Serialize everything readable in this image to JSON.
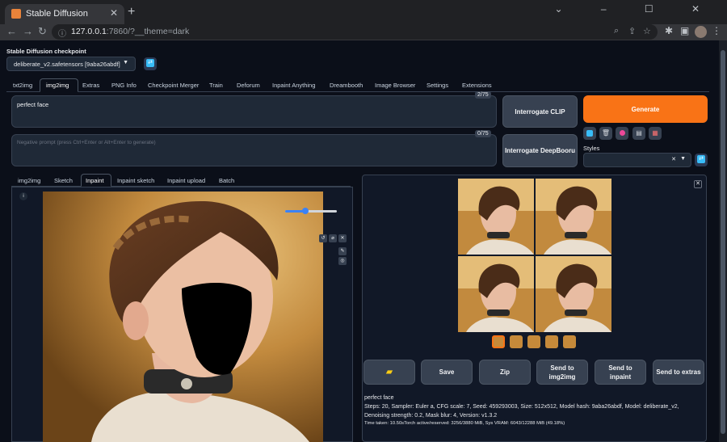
{
  "browser": {
    "tab_title": "Stable Diffusion",
    "tab_close": "✕",
    "new_tab": "+",
    "url_host": "127.0.0.1",
    "url_rest": ":7860/?__theme=dark",
    "window_controls": "⌄ – ☐ ✕"
  },
  "checkpoint": {
    "label": "Stable Diffusion checkpoint",
    "value": "deliberate_v2.safetensors [9aba26abdf]"
  },
  "main_tabs": [
    "txt2img",
    "img2img",
    "Extras",
    "PNG Info",
    "Checkpoint Merger",
    "Train",
    "Deforum",
    "Inpaint Anything",
    "Dreambooth",
    "Image Browser",
    "Settings",
    "Extensions"
  ],
  "main_tab_active": "img2img",
  "prompt": {
    "value": "perfect face",
    "counter": "2/75"
  },
  "negative_prompt": {
    "placeholder": "Negative prompt (press Ctrl+Enter or Alt+Enter to generate)",
    "counter": "0/75"
  },
  "buttons": {
    "interrogate_clip": "Interrogate CLIP",
    "interrogate_deepbooru": "Interrogate DeepBooru",
    "generate": "Generate"
  },
  "styles": {
    "label": "Styles"
  },
  "sub_tabs": [
    "img2img",
    "Sketch",
    "Inpaint",
    "Inpaint sketch",
    "Inpaint upload",
    "Batch"
  ],
  "sub_tab_active": "Inpaint",
  "output_buttons": {
    "save": "Save",
    "zip": "Zip",
    "send_img2img": "Send to img2img",
    "send_inpaint": "Send to inpaint",
    "send_extras": "Send to extras"
  },
  "generation_info": {
    "prompt": "perfect face",
    "params": "Steps: 20, Sampler: Euler a, CFG scale: 7, Seed: 459293003, Size: 512x512, Model hash: 9aba26abdf, Model: deliberate_v2, Denoising strength: 0.2, Mask blur: 4, Version: v1.3.2",
    "time": "Time taken: 10.50sTorch active/reserved: 3256/3880 MiB, Sys VRAM: 6043/12288 MiB (49.18%)"
  },
  "colors": {
    "accent": "#f97316",
    "background": "#0b0f19",
    "panel": "#1f2937",
    "refresh": "#38bdf8"
  }
}
